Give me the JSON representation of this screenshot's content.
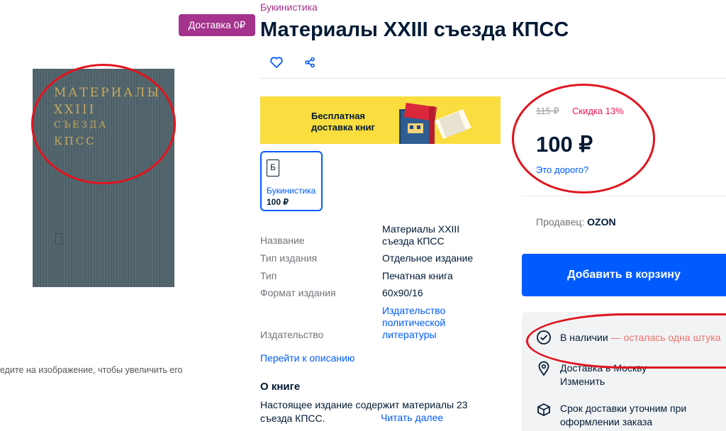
{
  "badge": {
    "delivery": "Доставка 0₽"
  },
  "cover": {
    "lines": [
      "МАТЕРИАЛЫ",
      "XXIII",
      "СЪЕЗДА",
      "КПСС"
    ]
  },
  "gallery": {
    "zoom_hint": "едите на изображение, чтобы увеличить его"
  },
  "header": {
    "category": "Букинистика",
    "title": "Материалы XXIII съезда КПСС"
  },
  "actions": {
    "favorite_icon": "heart-icon",
    "share_icon": "share-icon"
  },
  "banner": {
    "line1": "Бесплатная",
    "line2": "доставка книг"
  },
  "variant": {
    "icon_letter": "Б",
    "name": "Букинистика",
    "price": "100 ₽"
  },
  "specs": [
    {
      "label": "Название",
      "value": "Материалы XXIII съезда КПСС"
    },
    {
      "label": "Тип издания",
      "value": "Отдельное издание"
    },
    {
      "label": "Тип",
      "value": "Печатная книга"
    },
    {
      "label": "Формат издания",
      "value": "60x90/16"
    },
    {
      "label": "Издательство",
      "value": "Издательство политической литературы"
    }
  ],
  "description": {
    "goto_link": "Перейти к описанию",
    "heading": "О книге",
    "text": "Настоящее издание содержит материалы 23 съезда КПСС.",
    "read_more": "Читать далее"
  },
  "pricing": {
    "old_price": "115 ₽",
    "discount": "Скидка 13%",
    "price": "100 ₽",
    "expensive_link": "Это дорого?"
  },
  "seller": {
    "label": "Продавец:",
    "name": "OZON"
  },
  "cart": {
    "button": "Добавить в корзину"
  },
  "availability": {
    "in_stock": "В наличии",
    "remaining": "— осталась одна штука",
    "delivery": "Доставка в Москву",
    "change_link": "Изменить",
    "term_line1": "Срок доставки уточним при",
    "term_line2": "оформлении заказа"
  },
  "colors": {
    "brand_blue": "#005bff",
    "accent_purple": "#a5328c",
    "discount_red": "#f91155",
    "annotation_red": "#e0141e"
  }
}
